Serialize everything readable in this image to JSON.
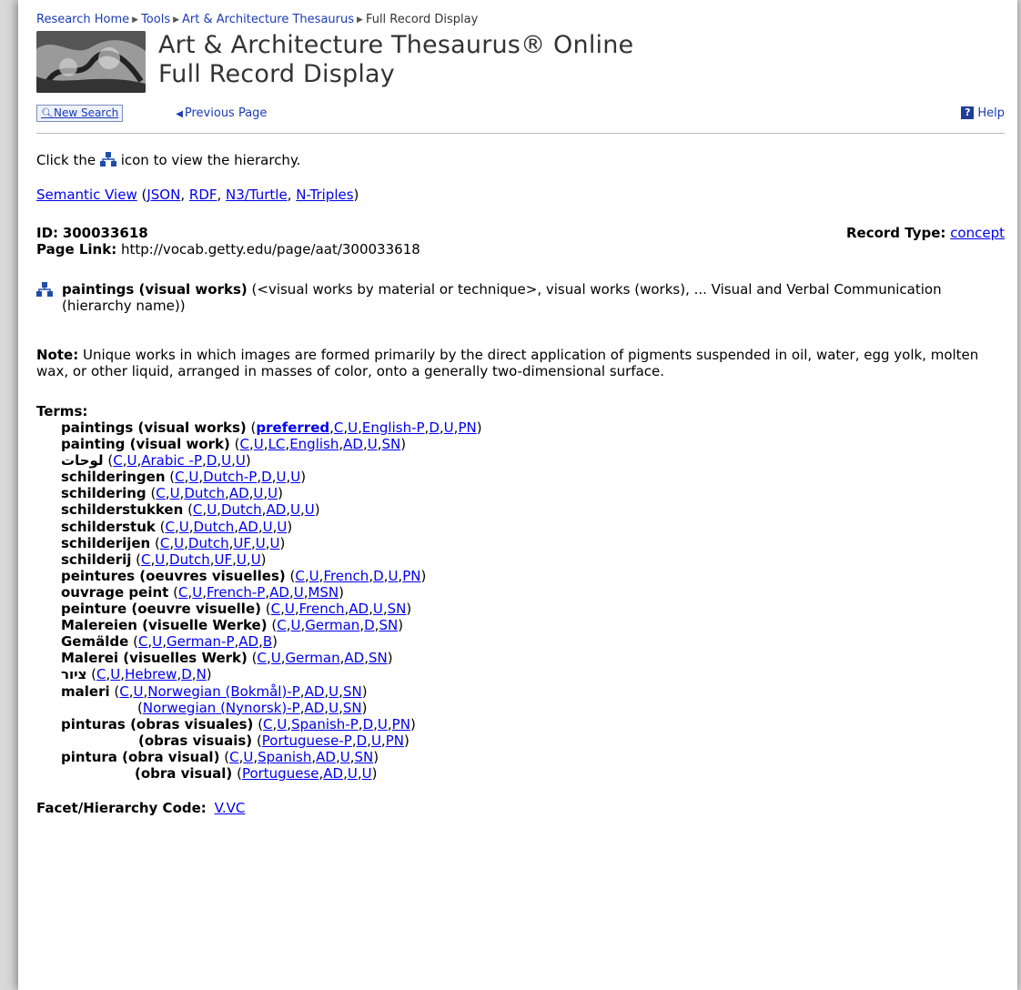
{
  "breadcrumb": [
    "Research Home",
    "Tools",
    "Art & Architecture Thesaurus",
    "Full Record Display"
  ],
  "header": {
    "title_line1": "Art & Architecture Thesaurus® Online",
    "title_line2": "Full Record Display"
  },
  "toolbar": {
    "new_search": "New Search",
    "previous_page": "Previous Page",
    "help": "Help"
  },
  "hint": {
    "before": "Click the",
    "after": "icon to view the hierarchy."
  },
  "semantic": {
    "view": "Semantic View",
    "formats": [
      "JSON",
      "RDF",
      "N3/Turtle",
      "N-Triples"
    ]
  },
  "record": {
    "id_label": "ID:",
    "id": "300033618",
    "type_label": "Record Type:",
    "type": "concept",
    "page_link_label": "Page Link:",
    "page_link": "http://vocab.getty.edu/page/aat/300033618"
  },
  "subject": {
    "name": "paintings (visual works)",
    "context": "(<visual works by material or technique>, visual works (works), ... Visual and Verbal Communication (hierarchy name))"
  },
  "note": {
    "label": "Note:",
    "text": "Unique works in which images are formed primarily by the direct application of pigments suspended in oil, water, egg yolk, molten wax, or other liquid, arranged in masses of color, onto a generally two-dimensional surface."
  },
  "terms_label": "Terms:",
  "terms": [
    {
      "term": "paintings (visual works)",
      "flags": [
        "preferred",
        "C",
        "U",
        "English-P",
        "D",
        "U",
        "PN"
      ],
      "bold_first": true
    },
    {
      "term": "painting (visual work)",
      "flags": [
        "C",
        "U",
        "LC",
        "English",
        "AD",
        "U",
        "SN"
      ]
    },
    {
      "term": "لوحات",
      "flags": [
        "C",
        "U",
        "Arabic -P",
        "D",
        "U",
        "U"
      ]
    },
    {
      "term": "schilderingen",
      "flags": [
        "C",
        "U",
        "Dutch-P",
        "D",
        "U",
        "U"
      ]
    },
    {
      "term": "schildering",
      "flags": [
        "C",
        "U",
        "Dutch",
        "AD",
        "U",
        "U"
      ]
    },
    {
      "term": "schilderstukken",
      "flags": [
        "C",
        "U",
        "Dutch",
        "AD",
        "U",
        "U"
      ]
    },
    {
      "term": "schilderstuk",
      "flags": [
        "C",
        "U",
        "Dutch",
        "AD",
        "U",
        "U"
      ]
    },
    {
      "term": "schilderijen",
      "flags": [
        "C",
        "U",
        "Dutch",
        "UF",
        "U",
        "U"
      ]
    },
    {
      "term": "schilderij",
      "flags": [
        "C",
        "U",
        "Dutch",
        "UF",
        "U",
        "U"
      ]
    },
    {
      "term": "peintures (oeuvres visuelles)",
      "flags": [
        "C",
        "U",
        "French",
        "D",
        "U",
        "PN"
      ]
    },
    {
      "term": "ouvrage peint",
      "flags": [
        "C",
        "U",
        "French-P",
        "AD",
        "U",
        "MSN"
      ]
    },
    {
      "term": "peinture (oeuvre visuelle)",
      "flags": [
        "C",
        "U",
        "French",
        "AD",
        "U",
        "SN"
      ]
    },
    {
      "term": "Malereien (visuelle Werke)",
      "flags": [
        "C",
        "U",
        "German",
        "D",
        "SN"
      ]
    },
    {
      "term": "Gemälde",
      "flags": [
        "C",
        "U",
        "German-P",
        "AD",
        "B"
      ]
    },
    {
      "term": "Malerei (visuelles Werk)",
      "flags": [
        "C",
        "U",
        "German",
        "AD",
        "SN"
      ]
    },
    {
      "term": "ציור",
      "flags": [
        "C",
        "U",
        "Hebrew",
        "D",
        "N"
      ]
    },
    {
      "term": "maleri",
      "flags": [
        "C",
        "U",
        "Norwegian (Bokmål)-P",
        "AD",
        "U",
        "SN"
      ]
    },
    {
      "term": "",
      "flags": [
        "Norwegian (Nynorsk)-P",
        "AD",
        "U",
        "SN"
      ],
      "indent": 84
    },
    {
      "term": "pinturas (obras visuales)",
      "flags": [
        "C",
        "U",
        "Spanish-P",
        "D",
        "U",
        "PN"
      ]
    },
    {
      "term": "(obras visuais)",
      "flags": [
        "Portuguese-P",
        "D",
        "U",
        "PN"
      ],
      "indent": 85
    },
    {
      "term": "pintura (obra visual)",
      "flags": [
        "C",
        "U",
        "Spanish",
        "AD",
        "U",
        "SN"
      ]
    },
    {
      "term": "(obra visual)",
      "flags": [
        "Portuguese",
        "AD",
        "U",
        "U"
      ],
      "indent": 81
    }
  ],
  "facet": {
    "label": "Facet/Hierarchy Code:",
    "code": "V.VC"
  },
  "colors": {
    "link": "#0000ee",
    "nav_link": "#1a3bb5",
    "help_icon": "#1f3f99"
  },
  "icons": {
    "hierarchy": "hierarchy-icon",
    "search": "search-icon",
    "help": "help-icon",
    "previous": "triangle-left-icon"
  }
}
